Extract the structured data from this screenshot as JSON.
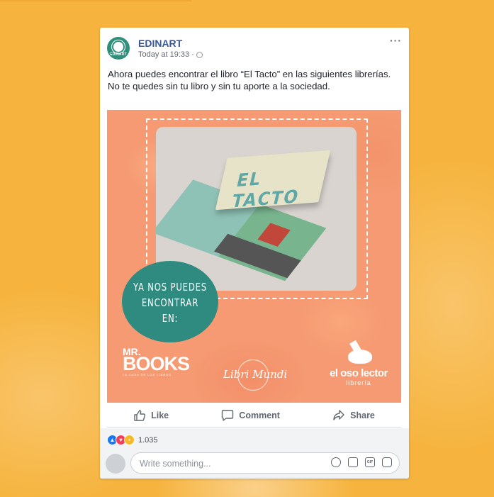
{
  "post": {
    "page_name": "EDINART",
    "avatar_text": "EDINART",
    "timestamp": "Today at 19:33",
    "separator": "·",
    "more": "···",
    "text": "Ahora puedes encontrar el libro “El Tacto” en las siguientes librerías. No te quedes sin tu libro y sin tu aporte a la sociedad."
  },
  "image": {
    "book_title": "EL TACTO",
    "badge_line1": "YA NOS PUEDES",
    "badge_line2": "ENCONTRAR EN:",
    "logo_mrbooks_1": "MR.",
    "logo_mrbooks_2": "BOOKS",
    "logo_mrbooks_sub": "LA CASA DE LOS LIBROS",
    "logo_libromundi": "Libri Mundi",
    "logo_oso_name": "el oso lector",
    "logo_oso_sub": "librería"
  },
  "actions": {
    "like": "Like",
    "comment": "Comment",
    "share": "Share"
  },
  "reactions": {
    "count": "1.035"
  },
  "comment_box": {
    "placeholder": "Write something..."
  },
  "colors": {
    "background": "#f6b43e",
    "image_bg": "#f59a72",
    "badge": "#2f8a7f",
    "page_link": "#385898"
  }
}
